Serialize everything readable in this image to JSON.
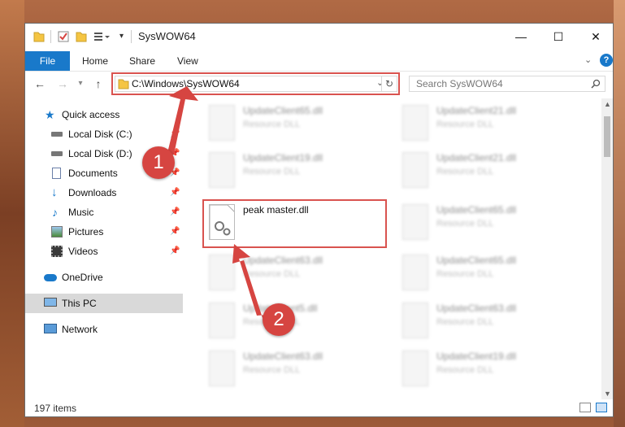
{
  "window": {
    "title": "SysWOW64",
    "minimize_symbol": "—",
    "maximize_symbol": "☐",
    "close_symbol": "✕"
  },
  "ribbon": {
    "file_tab": "File",
    "tabs": [
      "Home",
      "Share",
      "View"
    ],
    "help_symbol": "?"
  },
  "address": {
    "path": "C:\\Windows\\SysWOW64",
    "search_placeholder": "Search SysWOW64"
  },
  "sidebar": {
    "items": [
      {
        "label": "Quick access",
        "icon": "star-icon",
        "pinned": false
      },
      {
        "label": "Local Disk (C:)",
        "icon": "drive-icon",
        "pinned": true
      },
      {
        "label": "Local Disk (D:)",
        "icon": "drive-icon",
        "pinned": true
      },
      {
        "label": "Documents",
        "icon": "documents-icon",
        "pinned": true
      },
      {
        "label": "Downloads",
        "icon": "downloads-icon",
        "pinned": true
      },
      {
        "label": "Music",
        "icon": "music-icon",
        "pinned": true
      },
      {
        "label": "Pictures",
        "icon": "pictures-icon",
        "pinned": true
      },
      {
        "label": "Videos",
        "icon": "videos-icon",
        "pinned": true
      },
      {
        "label": "OneDrive",
        "icon": "cloud-icon",
        "pinned": false
      },
      {
        "label": "This PC",
        "icon": "computer-icon",
        "pinned": false,
        "selected": true
      },
      {
        "label": "Network",
        "icon": "network-icon",
        "pinned": false
      }
    ]
  },
  "files": {
    "left": [
      {
        "name": "UpdateClient65.dll",
        "type": "Resource DLL"
      },
      {
        "name": "UpdateClient19.dll",
        "type": "Resource DLL"
      },
      {
        "name": "peak master.dll",
        "type": ""
      },
      {
        "name": "UpdateClient63.dll",
        "type": "Resource DLL"
      },
      {
        "name": "UpdateClient5.dll",
        "type": "Resource DLL"
      },
      {
        "name": "UpdateClient63.dll",
        "type": "Resource DLL"
      }
    ],
    "right": [
      {
        "name": "UpdateClient21.dll",
        "type": "Resource DLL"
      },
      {
        "name": "UpdateClient21.dll",
        "type": "Resource DLL"
      },
      {
        "name": "UpdateClient65.dll",
        "type": "Resource DLL"
      },
      {
        "name": "UpdateClient65.dll",
        "type": "Resource DLL"
      },
      {
        "name": "UpdateClient63.dll",
        "type": "Resource DLL"
      },
      {
        "name": "UpdateClient19.dll",
        "type": "Resource DLL"
      }
    ]
  },
  "status": {
    "item_count": "197 items"
  },
  "callouts": [
    "1",
    "2"
  ],
  "colors": {
    "accent": "#1979ca",
    "highlight": "#d9534f"
  }
}
